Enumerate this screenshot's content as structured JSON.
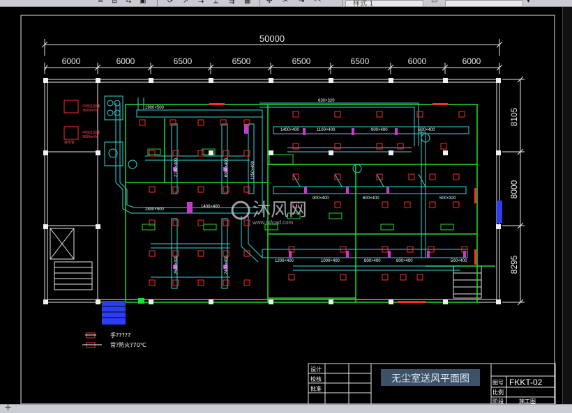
{
  "toolbar": {
    "style_field": "样式 1"
  },
  "drawing": {
    "overall_dimension": "50000",
    "column_dimensions": [
      "6000",
      "6000",
      "6500",
      "6500",
      "6500",
      "6500",
      "6000",
      "6000"
    ],
    "row_dimensions": [
      "8105",
      "8000",
      "8295"
    ],
    "duct_labels": [
      "630×320",
      "1900×500",
      "1400×400",
      "1100×400",
      "900×400",
      "600×400",
      "2700×400",
      "6000×400",
      "1250×400",
      "2800×500",
      "1400×400",
      "900×400",
      "600×400",
      "500×320",
      "2500×400",
      "1200×400",
      "1000×400",
      "800×400",
      "800×400",
      "500×400",
      "2400×400"
    ],
    "equipment_labels": [
      "中效过滤器",
      "3600m³/h",
      "中效过滤器",
      "3600m³/h",
      "排风管"
    ],
    "legend": [
      {
        "symbol": "damper",
        "text": "手?????"
      },
      {
        "symbol": "fire-damper",
        "text": "常?防火?70℃"
      }
    ],
    "watermark": "沐风网",
    "watermark_url": "www.mfcad.com",
    "title_block": {
      "rows": [
        "设计",
        "校核",
        "批准"
      ],
      "title": "无尘室送风平面图",
      "drawing_no_label": "图号",
      "drawing_no": "FKKT-02",
      "scale_label": "比例",
      "stage_label": "阶段",
      "stage": "施工图"
    }
  }
}
